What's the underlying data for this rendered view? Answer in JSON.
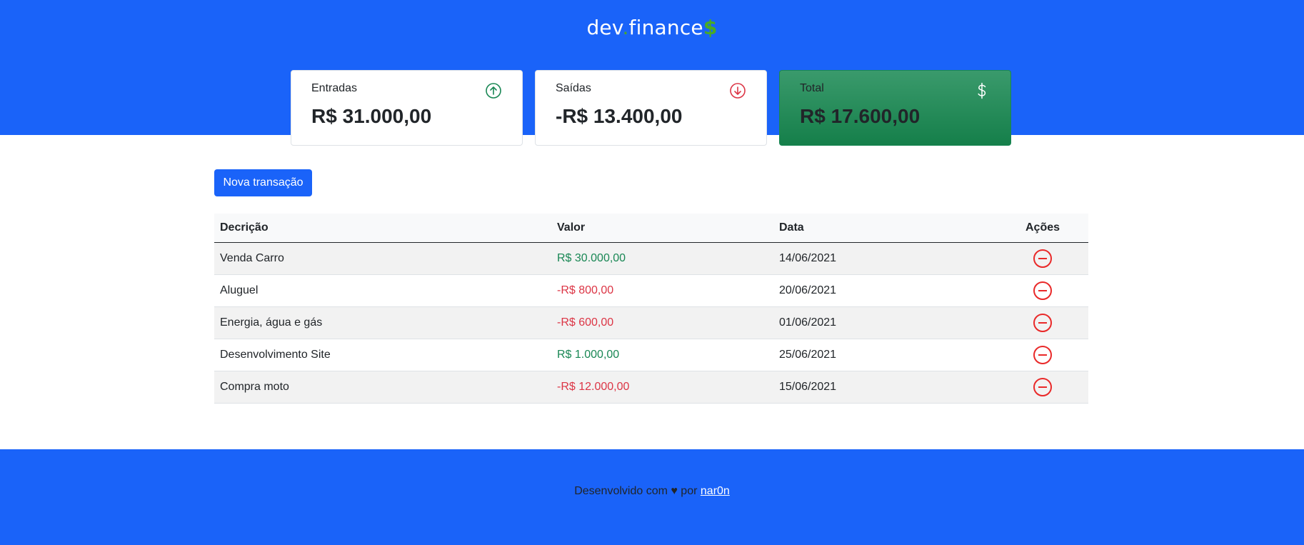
{
  "header": {
    "logo": {
      "part1": "dev",
      "dot": ".",
      "part2": "finance",
      "dollar": "$"
    }
  },
  "cards": {
    "income": {
      "label": "Entradas",
      "value": "R$ 31.000,00",
      "icon": "arrow-up-circle-icon"
    },
    "expense": {
      "label": "Saídas",
      "value": "-R$ 13.400,00",
      "icon": "arrow-down-circle-icon"
    },
    "total": {
      "label": "Total",
      "value": "R$ 17.600,00",
      "icon": "dollar-icon"
    }
  },
  "actions": {
    "new_transaction_label": "Nova transação"
  },
  "table": {
    "headers": {
      "description": "Decrição",
      "value": "Valor",
      "date": "Data",
      "actions": "Ações"
    },
    "rows": [
      {
        "description": "Venda Carro",
        "value": "R$ 30.000,00",
        "date": "14/06/2021",
        "type": "income"
      },
      {
        "description": "Aluguel",
        "value": "-R$ 800,00",
        "date": "20/06/2021",
        "type": "expense"
      },
      {
        "description": "Energia, água e gás",
        "value": "-R$ 600,00",
        "date": "01/06/2021",
        "type": "expense"
      },
      {
        "description": "Desenvolvimento Site",
        "value": "R$ 1.000,00",
        "date": "25/06/2021",
        "type": "income"
      },
      {
        "description": "Compra moto",
        "value": "-R$ 12.000,00",
        "date": "15/06/2021",
        "type": "expense"
      }
    ]
  },
  "footer": {
    "text": "Desenvolvido com ♥ por",
    "author": "nar0n"
  },
  "colors": {
    "brand_blue": "#1a63f9",
    "income_green": "#198754",
    "expense_red": "#dc3545"
  }
}
